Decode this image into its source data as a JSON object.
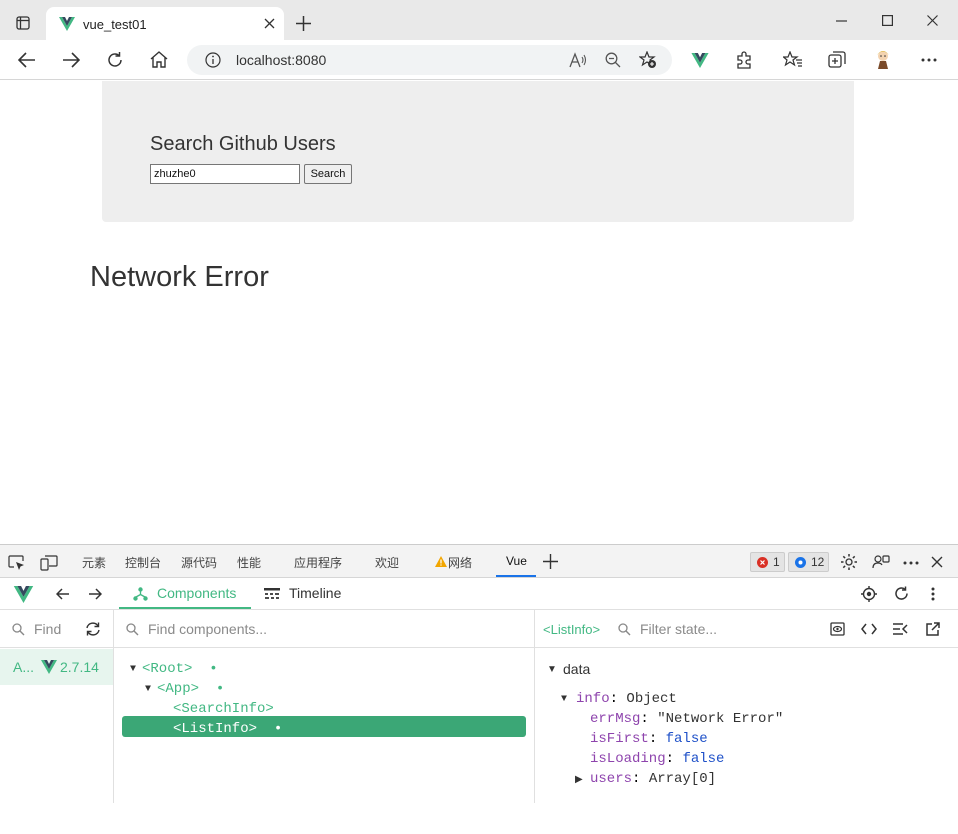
{
  "browser": {
    "tab_title": "vue_test01",
    "address": "localhost:8080"
  },
  "page": {
    "jumbotron_title": "Search Github Users",
    "search_value": "zhuzhe0",
    "search_button": "Search",
    "error_message": "Network Error"
  },
  "devtools": {
    "tabs": [
      "元素",
      "控制台",
      "源代码",
      "性能",
      "应用程序",
      "欢迎",
      "网络",
      "Vue"
    ],
    "error_count": "1",
    "message_count": "12",
    "vue": {
      "components_tab": "Components",
      "timeline_tab": "Timeline",
      "find_placeholder": "Find",
      "find_components_placeholder": "Find components...",
      "filter_state_placeholder": "Filter state...",
      "app_name": "A...",
      "vue_version": "2.7.14",
      "selected_component": "<ListInfo>",
      "tree": [
        {
          "label": "<Root>",
          "dot": "•"
        },
        {
          "label": "<App>",
          "dot": "•"
        },
        {
          "label": "<SearchInfo>",
          "dot": ""
        },
        {
          "label": "<ListInfo>",
          "dot": "•"
        }
      ],
      "state": {
        "section": "data",
        "info_key": "info",
        "info_type": "Object",
        "props": [
          {
            "key": "errMsg",
            "value": "\"Network Error\""
          },
          {
            "key": "isFirst",
            "value": "false"
          },
          {
            "key": "isLoading",
            "value": "false"
          },
          {
            "key": "users",
            "value": "Array[0]"
          }
        ]
      }
    }
  },
  "colors": {
    "vue_green": "#42b883",
    "selection": "#3ba776",
    "prop_key": "#8e44ad",
    "bool_value": "#1e50c8"
  }
}
